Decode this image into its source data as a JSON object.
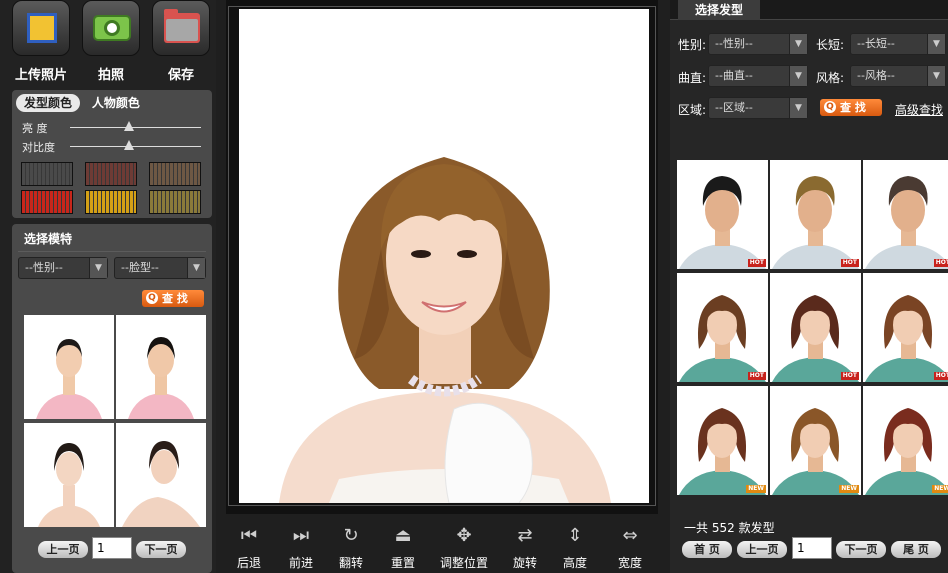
{
  "toolbar": {
    "upload_label": "上传照片",
    "camera_label": "拍照",
    "save_label": "保存"
  },
  "color_panel": {
    "tabs": [
      "发型颜色",
      "人物颜色"
    ],
    "active_tab": 0,
    "brightness_label": "亮 度",
    "contrast_label": "对比度",
    "brightness_level": 0.45,
    "contrast_level": 0.45,
    "swatches": [
      "#4a4a4a",
      "#6e3b35",
      "#6e5844",
      "#c8261b",
      "#d4a016",
      "#8a7a3a"
    ]
  },
  "model_panel": {
    "title": "选择模特",
    "gender_select": "--性别--",
    "face_select": "--脸型--",
    "find_label": "查 找",
    "page_value": "1",
    "prev_label": "上一页",
    "next_label": "下一页"
  },
  "bottom_toolbar": {
    "items": [
      {
        "label": "后退",
        "icon": "back-icon"
      },
      {
        "label": "前进",
        "icon": "forward-icon"
      },
      {
        "label": "翻转",
        "icon": "flip-icon"
      },
      {
        "label": "重置",
        "icon": "reset-icon"
      },
      {
        "label": "调整位置",
        "icon": "move-icon"
      },
      {
        "label": "旋转",
        "icon": "rotate-icon"
      },
      {
        "label": "高度",
        "icon": "height-icon"
      },
      {
        "label": "宽度",
        "icon": "width-icon"
      }
    ]
  },
  "hairstyle_panel": {
    "tab_label": "选择发型",
    "gender_label": "性别:",
    "gender_select": "--性别--",
    "length_label": "长短:",
    "length_select": "--长短--",
    "curl_label": "曲直:",
    "curl_select": "--曲直--",
    "style_label": "风格:",
    "style_select": "--风格--",
    "region_label": "区域:",
    "region_select": "--区域--",
    "find_label": "查 找",
    "advanced_label": "高级查找",
    "thumbs": [
      {
        "badge": "HOT",
        "hair": "#1a1a1a",
        "kind": "male"
      },
      {
        "badge": "HOT",
        "hair": "#8a6a30",
        "kind": "male"
      },
      {
        "badge": "HOT",
        "hair": "#4a3a32",
        "kind": "male"
      },
      {
        "badge": "HOT",
        "hair": "#6b3e22",
        "kind": "female"
      },
      {
        "badge": "HOT",
        "hair": "#5a2a1c",
        "kind": "female"
      },
      {
        "badge": "HOT",
        "hair": "#7a4424",
        "kind": "female"
      },
      {
        "badge": "NEW",
        "hair": "#6a321e",
        "kind": "female"
      },
      {
        "badge": "NEW",
        "hair": "#8a5628",
        "kind": "female"
      },
      {
        "badge": "NEW",
        "hair": "#7a2c1e",
        "kind": "female"
      }
    ],
    "total_prefix": "一共",
    "total_count": "552",
    "total_suffix": "款发型",
    "first_label": "首 页",
    "prev_label": "上一页",
    "page_value": "1",
    "next_label": "下一页",
    "last_label": "尾 页"
  },
  "colors": {
    "background": "#1f1f1f",
    "panel": "#4a4a4a",
    "find_button": "#e8681c",
    "hot_badge": "#c8231d",
    "new_badge": "#e08a12"
  }
}
